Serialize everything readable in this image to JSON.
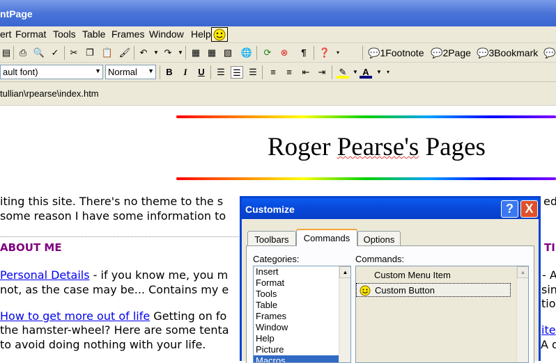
{
  "window": {
    "title": "ntPage"
  },
  "menu": [
    "ert",
    "Format",
    "Tools",
    "Table",
    "Frames",
    "Window",
    "Help"
  ],
  "format_toolbar": {
    "font": "ault font)",
    "style": "Normal"
  },
  "extra_toolbar": {
    "footnote": "1Footnote",
    "page": "2Page",
    "bookmark": "3Bookmark"
  },
  "path": "tullian\\rpearse\\index.htm",
  "page": {
    "title_part1": "Roger ",
    "title_word": "Pearse's",
    "title_part2": " Pages",
    "intro_line1": "iting this site.  There's no theme to the s",
    "intro_right1": "ed",
    "intro_line2": "some reason I have some information to",
    "about_heading": "ABOUT ME",
    "right_heading": "TI",
    "personal_link": "Personal Details",
    "personal_text": " - if you know me, you m",
    "personal_line2": "not, as the case may be... Contains my e",
    "right_a": "- A",
    "right_sin": "sin",
    "right_tio": "tio",
    "howto_link": "How to get more out of life",
    "howto_text": " Getting on fo",
    "howto_line2": "the hamster-wheel?  Here are some tenta",
    "howto_line3": "to avoid doing nothing with your life.",
    "right_ite": "ite",
    "right_q": "A q"
  },
  "dialog": {
    "title": "Customize",
    "help_label": "?",
    "close_label": "X",
    "tabs": [
      "Toolbars",
      "Commands",
      "Options"
    ],
    "categories_label": "Categories:",
    "commands_label": "Commands:",
    "categories": [
      "Insert",
      "Format",
      "Tools",
      "Table",
      "Frames",
      "Window",
      "Help",
      "Picture",
      "Macros"
    ],
    "commands": [
      "Custom Menu Item",
      "Custom Button"
    ]
  },
  "colors": {
    "title_blue": "#0842d0",
    "heading_purple": "#800080",
    "link_blue": "#0000ee"
  }
}
